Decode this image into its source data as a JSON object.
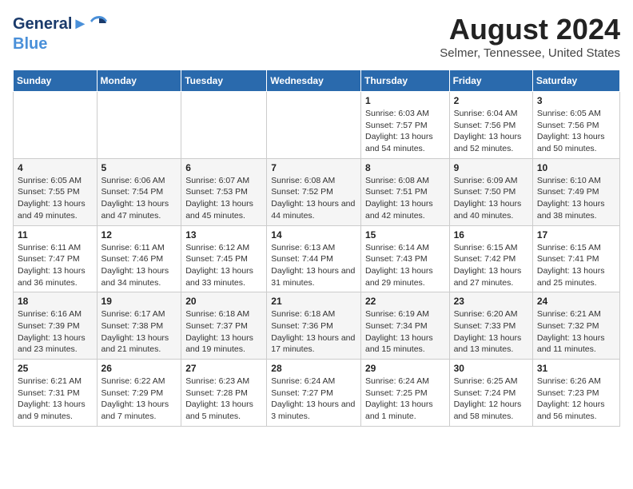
{
  "logo": {
    "line1": "General",
    "line2": "Blue"
  },
  "title": "August 2024",
  "subtitle": "Selmer, Tennessee, United States",
  "weekdays": [
    "Sunday",
    "Monday",
    "Tuesday",
    "Wednesday",
    "Thursday",
    "Friday",
    "Saturday"
  ],
  "weeks": [
    [
      {
        "day": "",
        "sunrise": "",
        "sunset": "",
        "daylight": ""
      },
      {
        "day": "",
        "sunrise": "",
        "sunset": "",
        "daylight": ""
      },
      {
        "day": "",
        "sunrise": "",
        "sunset": "",
        "daylight": ""
      },
      {
        "day": "",
        "sunrise": "",
        "sunset": "",
        "daylight": ""
      },
      {
        "day": "1",
        "sunrise": "Sunrise: 6:03 AM",
        "sunset": "Sunset: 7:57 PM",
        "daylight": "Daylight: 13 hours and 54 minutes."
      },
      {
        "day": "2",
        "sunrise": "Sunrise: 6:04 AM",
        "sunset": "Sunset: 7:56 PM",
        "daylight": "Daylight: 13 hours and 52 minutes."
      },
      {
        "day": "3",
        "sunrise": "Sunrise: 6:05 AM",
        "sunset": "Sunset: 7:56 PM",
        "daylight": "Daylight: 13 hours and 50 minutes."
      }
    ],
    [
      {
        "day": "4",
        "sunrise": "Sunrise: 6:05 AM",
        "sunset": "Sunset: 7:55 PM",
        "daylight": "Daylight: 13 hours and 49 minutes."
      },
      {
        "day": "5",
        "sunrise": "Sunrise: 6:06 AM",
        "sunset": "Sunset: 7:54 PM",
        "daylight": "Daylight: 13 hours and 47 minutes."
      },
      {
        "day": "6",
        "sunrise": "Sunrise: 6:07 AM",
        "sunset": "Sunset: 7:53 PM",
        "daylight": "Daylight: 13 hours and 45 minutes."
      },
      {
        "day": "7",
        "sunrise": "Sunrise: 6:08 AM",
        "sunset": "Sunset: 7:52 PM",
        "daylight": "Daylight: 13 hours and 44 minutes."
      },
      {
        "day": "8",
        "sunrise": "Sunrise: 6:08 AM",
        "sunset": "Sunset: 7:51 PM",
        "daylight": "Daylight: 13 hours and 42 minutes."
      },
      {
        "day": "9",
        "sunrise": "Sunrise: 6:09 AM",
        "sunset": "Sunset: 7:50 PM",
        "daylight": "Daylight: 13 hours and 40 minutes."
      },
      {
        "day": "10",
        "sunrise": "Sunrise: 6:10 AM",
        "sunset": "Sunset: 7:49 PM",
        "daylight": "Daylight: 13 hours and 38 minutes."
      }
    ],
    [
      {
        "day": "11",
        "sunrise": "Sunrise: 6:11 AM",
        "sunset": "Sunset: 7:47 PM",
        "daylight": "Daylight: 13 hours and 36 minutes."
      },
      {
        "day": "12",
        "sunrise": "Sunrise: 6:11 AM",
        "sunset": "Sunset: 7:46 PM",
        "daylight": "Daylight: 13 hours and 34 minutes."
      },
      {
        "day": "13",
        "sunrise": "Sunrise: 6:12 AM",
        "sunset": "Sunset: 7:45 PM",
        "daylight": "Daylight: 13 hours and 33 minutes."
      },
      {
        "day": "14",
        "sunrise": "Sunrise: 6:13 AM",
        "sunset": "Sunset: 7:44 PM",
        "daylight": "Daylight: 13 hours and 31 minutes."
      },
      {
        "day": "15",
        "sunrise": "Sunrise: 6:14 AM",
        "sunset": "Sunset: 7:43 PM",
        "daylight": "Daylight: 13 hours and 29 minutes."
      },
      {
        "day": "16",
        "sunrise": "Sunrise: 6:15 AM",
        "sunset": "Sunset: 7:42 PM",
        "daylight": "Daylight: 13 hours and 27 minutes."
      },
      {
        "day": "17",
        "sunrise": "Sunrise: 6:15 AM",
        "sunset": "Sunset: 7:41 PM",
        "daylight": "Daylight: 13 hours and 25 minutes."
      }
    ],
    [
      {
        "day": "18",
        "sunrise": "Sunrise: 6:16 AM",
        "sunset": "Sunset: 7:39 PM",
        "daylight": "Daylight: 13 hours and 23 minutes."
      },
      {
        "day": "19",
        "sunrise": "Sunrise: 6:17 AM",
        "sunset": "Sunset: 7:38 PM",
        "daylight": "Daylight: 13 hours and 21 minutes."
      },
      {
        "day": "20",
        "sunrise": "Sunrise: 6:18 AM",
        "sunset": "Sunset: 7:37 PM",
        "daylight": "Daylight: 13 hours and 19 minutes."
      },
      {
        "day": "21",
        "sunrise": "Sunrise: 6:18 AM",
        "sunset": "Sunset: 7:36 PM",
        "daylight": "Daylight: 13 hours and 17 minutes."
      },
      {
        "day": "22",
        "sunrise": "Sunrise: 6:19 AM",
        "sunset": "Sunset: 7:34 PM",
        "daylight": "Daylight: 13 hours and 15 minutes."
      },
      {
        "day": "23",
        "sunrise": "Sunrise: 6:20 AM",
        "sunset": "Sunset: 7:33 PM",
        "daylight": "Daylight: 13 hours and 13 minutes."
      },
      {
        "day": "24",
        "sunrise": "Sunrise: 6:21 AM",
        "sunset": "Sunset: 7:32 PM",
        "daylight": "Daylight: 13 hours and 11 minutes."
      }
    ],
    [
      {
        "day": "25",
        "sunrise": "Sunrise: 6:21 AM",
        "sunset": "Sunset: 7:31 PM",
        "daylight": "Daylight: 13 hours and 9 minutes."
      },
      {
        "day": "26",
        "sunrise": "Sunrise: 6:22 AM",
        "sunset": "Sunset: 7:29 PM",
        "daylight": "Daylight: 13 hours and 7 minutes."
      },
      {
        "day": "27",
        "sunrise": "Sunrise: 6:23 AM",
        "sunset": "Sunset: 7:28 PM",
        "daylight": "Daylight: 13 hours and 5 minutes."
      },
      {
        "day": "28",
        "sunrise": "Sunrise: 6:24 AM",
        "sunset": "Sunset: 7:27 PM",
        "daylight": "Daylight: 13 hours and 3 minutes."
      },
      {
        "day": "29",
        "sunrise": "Sunrise: 6:24 AM",
        "sunset": "Sunset: 7:25 PM",
        "daylight": "Daylight: 13 hours and 1 minute."
      },
      {
        "day": "30",
        "sunrise": "Sunrise: 6:25 AM",
        "sunset": "Sunset: 7:24 PM",
        "daylight": "Daylight: 12 hours and 58 minutes."
      },
      {
        "day": "31",
        "sunrise": "Sunrise: 6:26 AM",
        "sunset": "Sunset: 7:23 PM",
        "daylight": "Daylight: 12 hours and 56 minutes."
      }
    ]
  ]
}
